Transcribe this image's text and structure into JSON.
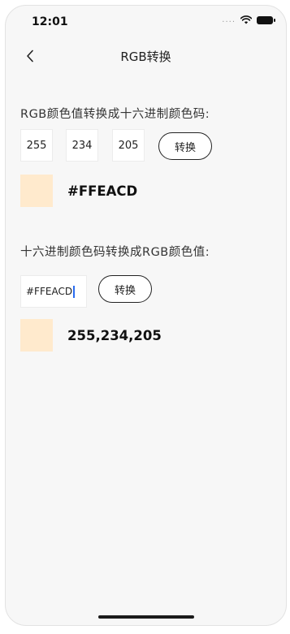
{
  "status_bar": {
    "time": "12:01",
    "signal_dots": "...."
  },
  "nav": {
    "title": "RGB转换"
  },
  "rgb_to_hex": {
    "label": "RGB颜色值转换成十六进制颜色码:",
    "r": "255",
    "g": "234",
    "b": "205",
    "button_label": "转换",
    "swatch_color": "#FFEACD",
    "result": "#FFEACD"
  },
  "hex_to_rgb": {
    "label": "十六进制颜色码转换成RGB颜色值:",
    "input_value": "#FFEACD",
    "button_label": "转换",
    "swatch_color": "#FFEACD",
    "result": "255,234,205"
  },
  "icons": {
    "back": "chevron-left-icon",
    "wifi": "wifi-icon",
    "battery": "battery-icon"
  }
}
